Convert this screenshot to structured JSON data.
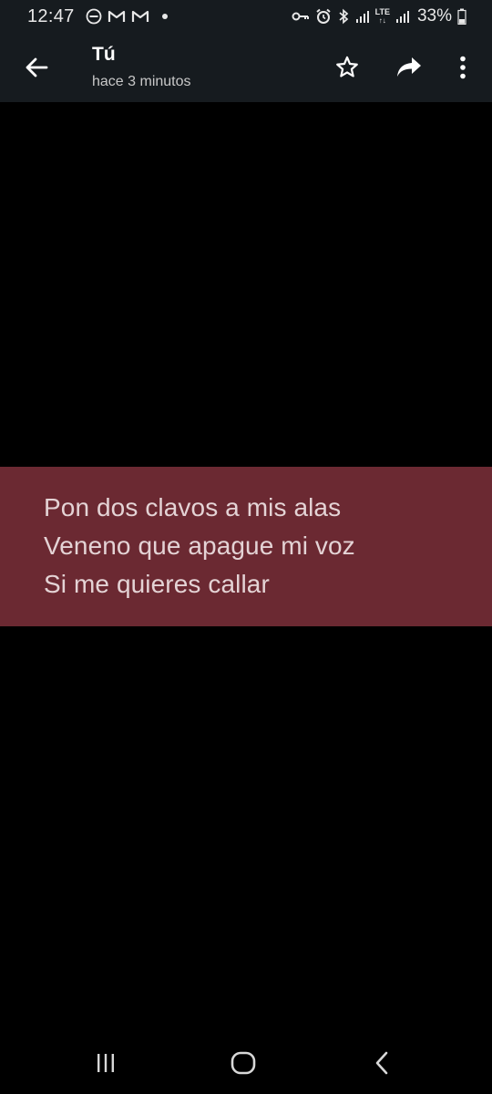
{
  "status_bar": {
    "time": "12:47",
    "battery": "33%",
    "network": "LTE"
  },
  "header": {
    "title": "Tú",
    "subtitle": "hace 3 minutos"
  },
  "story": {
    "background_color": "#000000",
    "card_color": "#6b2932",
    "lines": [
      "Pon dos clavos a mis alas",
      "Veneno que apague mi voz",
      "Si me quieres callar"
    ]
  },
  "icons": {
    "back": "arrow-left-icon",
    "star": "star-outline-icon",
    "share": "share-arrow-icon",
    "more": "more-vertical-icon"
  }
}
